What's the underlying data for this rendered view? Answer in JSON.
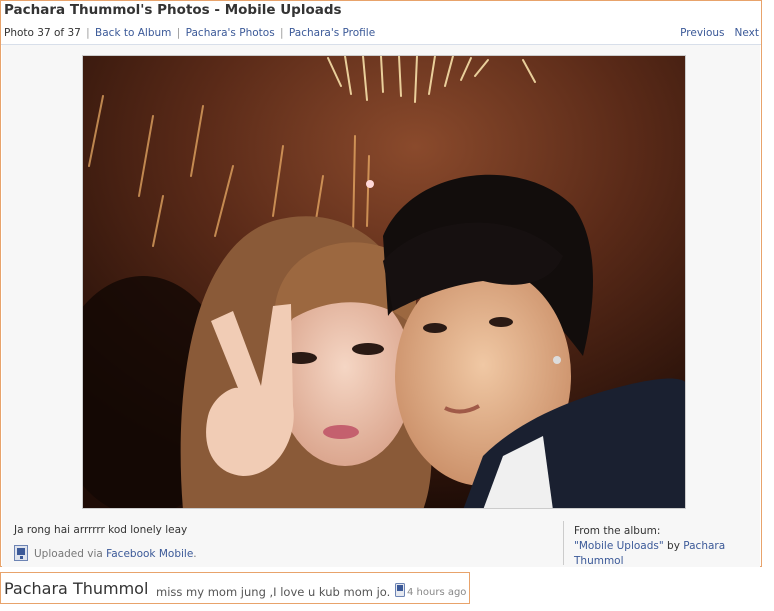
{
  "header": {
    "title": "Pachara Thummol's Photos - Mobile Uploads"
  },
  "nav": {
    "photo_count": "Photo 37 of 37",
    "back_to_album": "Back to Album",
    "user_photos": "Pachara's Photos",
    "user_profile": "Pachara's Profile",
    "separator": "|",
    "previous": "Previous",
    "next": "Next"
  },
  "photo": {
    "icon": "photo-image"
  },
  "details": {
    "caption": "Ja rong hai arrrrrr kod lonely leay",
    "uploaded_prefix": "Uploaded via ",
    "uploaded_link": "Facebook Mobile",
    "uploaded_suffix": ".",
    "from_album_label": "From the album:",
    "album_name": "\"Mobile Uploads\"",
    "by": " by ",
    "album_owner": "Pachara Thummol"
  },
  "status": {
    "name": "Pachara Thummol",
    "message": "miss my mom jung ,I love u kub mom jo.",
    "time": "4 hours ago"
  },
  "colors": {
    "link": "#3b5998",
    "frame_border": "#e8a36b",
    "panel_bg": "#f7f7f7"
  }
}
